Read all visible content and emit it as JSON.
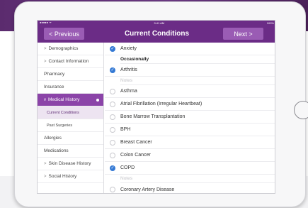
{
  "navbar": {
    "previous_label": "< Previous",
    "title": "Current Conditions",
    "next_label": "Next >"
  },
  "status_bar": {
    "time": "9:41 AM",
    "battery": "100%"
  },
  "colors": {
    "brand_purple": "#6b2c86",
    "button_purple": "#9a5cb4",
    "check_blue": "#3479d4"
  },
  "sidebar": {
    "items": [
      {
        "label": "Demographics",
        "chevron": ">"
      },
      {
        "label": "Contact Information",
        "chevron": ">"
      },
      {
        "label": "Pharmacy"
      },
      {
        "label": "Insurance"
      },
      {
        "label": "Medical History",
        "chevron": "v"
      },
      {
        "label": "Current Conditions"
      },
      {
        "label": "Past Surgeries"
      },
      {
        "label": "Allergies"
      },
      {
        "label": "Medications"
      },
      {
        "label": "Skin Disease History",
        "chevron": ">"
      },
      {
        "label": "Social History",
        "chevron": ">"
      }
    ]
  },
  "conditions": [
    {
      "label": "Anxiety",
      "checked": true,
      "detail": "Occasionally"
    },
    {
      "label": "Arthritis",
      "checked": true,
      "notes_placeholder": "Notes"
    },
    {
      "label": "Asthma",
      "checked": false
    },
    {
      "label": "Atrial Fibrillation (Irregular Heartbeat)",
      "checked": false
    },
    {
      "label": "Bone Marrow Transplantation",
      "checked": false
    },
    {
      "label": "BPH",
      "checked": false
    },
    {
      "label": "Breast Cancer",
      "checked": false
    },
    {
      "label": "Colon Cancer",
      "checked": false
    },
    {
      "label": "COPD",
      "checked": true,
      "notes_placeholder": "Notes"
    },
    {
      "label": "Coronary Artery Disease",
      "checked": false
    }
  ]
}
